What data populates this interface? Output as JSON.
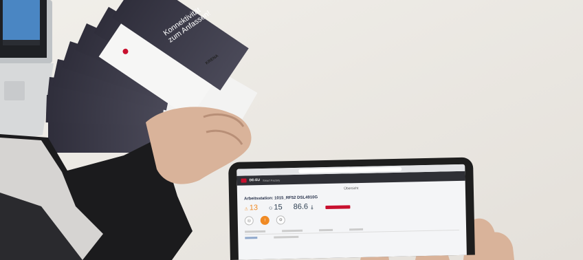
{
  "brochure": {
    "title_line1": "Konnektivität",
    "title_line2": "zum Anfassen!",
    "brand": "KRENA"
  },
  "tablet_app": {
    "app_name": "DE-EU",
    "app_sub": "Smart Factory",
    "section_header": "Übersicht",
    "device_title": "Arbeitsstation: 1015_RF52 DSL4910G",
    "metrics": [
      {
        "value": "13",
        "icon": "warning-icon",
        "color": "#f08a24"
      },
      {
        "value": "15",
        "icon": "person-icon",
        "color": "#2c3e50"
      },
      {
        "value": "86.6",
        "icon": "thermometer-icon",
        "color": "#2c3e50"
      }
    ],
    "status_color": "#c8102e"
  },
  "colors": {
    "table": "#efece7",
    "brochure_dark": "#3a3947",
    "brochure_light": "#f3f3f2",
    "brand_red": "#c8102e",
    "sleeve": "#1b1b1d",
    "skin": "#d9b39a"
  }
}
